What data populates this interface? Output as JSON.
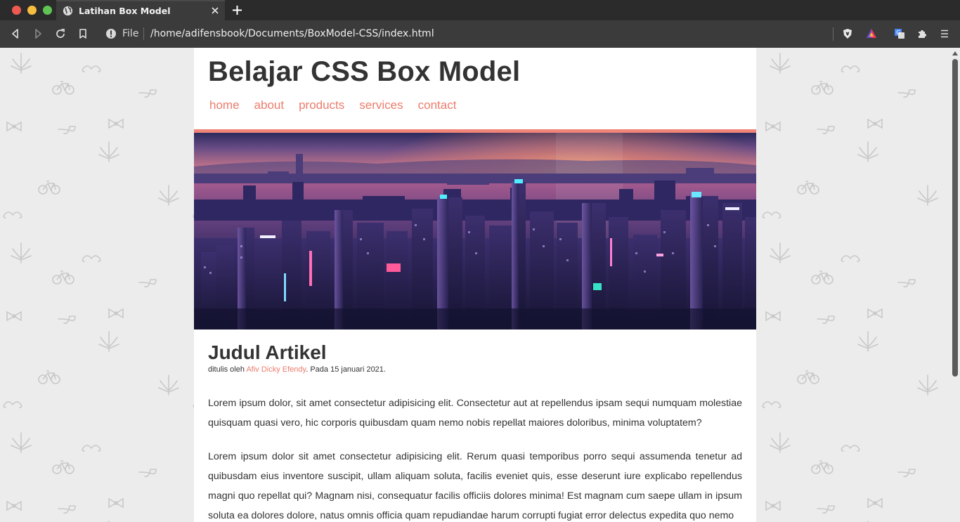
{
  "browser": {
    "tab_title": "Latihan Box Model",
    "scheme": "File",
    "url": "/home/adifensbook/Documents/BoxModel-CSS/index.html"
  },
  "icons": {
    "back": "arrow-left-icon",
    "forward": "arrow-right-icon",
    "reload": "reload-icon",
    "bookmark": "bookmark-icon",
    "site_info": "info-icon",
    "brave": "brave-shield-icon",
    "rewards": "brave-rewards-icon",
    "translate": "translate-icon",
    "extensions": "puzzle-icon",
    "menu": "hamburger-menu-icon"
  },
  "colors": {
    "accent": "#ec7c6c",
    "text": "#333333",
    "page_bg": "#ececec"
  },
  "page": {
    "site_title": "Belajar CSS Box Model",
    "nav": [
      "home",
      "about",
      "products",
      "services",
      "contact"
    ],
    "article": {
      "title": "Judul Artikel",
      "byline_prefix": "ditulis oleh ",
      "author": "Afiv Dicky Efendy",
      "byline_suffix": ". Pada 15 januari 2021.",
      "paragraphs": [
        "Lorem ipsum dolor, sit amet consectetur adipisicing elit. Consectetur aut at repellendus ipsam sequi numquam molestiae quisquam quasi vero, hic corporis quibusdam quam nemo nobis repellat maiores doloribus, minima voluptatem?",
        "Lorem ipsum dolor sit amet consectetur adipisicing elit. Rerum quasi temporibus porro sequi assumenda tenetur ad quibusdam eius inventore suscipit, ullam aliquam soluta, facilis eveniet quis, esse deserunt iure explicabo repellendus magni quo repellat qui? Magnam nisi, consequatur facilis officiis dolores minima! Est magnam cum saepe ullam in ipsum soluta ea dolores dolore, natus omnis officia quam repudiandae harum corrupti fugiat error delectus expedita quo nemo"
      ]
    }
  }
}
